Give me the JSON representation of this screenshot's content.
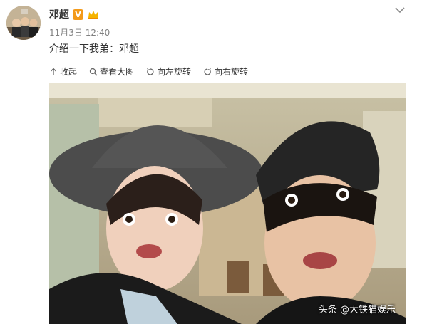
{
  "author": {
    "name": "邓超",
    "verified_badge": "V"
  },
  "post": {
    "timestamp": "11月3日 12:40",
    "text": "介绍一下我弟：邓超"
  },
  "toolbar": {
    "collapse": "收起",
    "view_large": "查看大图",
    "rotate_left": "向左旋转",
    "rotate_right": "向右旋转"
  },
  "photo": {
    "watermark": "头条 @大铁猫娱乐"
  },
  "icons": {
    "collapse": "arrow-up-icon",
    "view_large": "magnifier-icon",
    "rotate_left": "rotate-left-icon",
    "rotate_right": "rotate-right-icon",
    "menu": "chevron-down-icon"
  },
  "colors": {
    "verified": "#f39a1a",
    "text": "#333333",
    "meta": "#808080"
  }
}
